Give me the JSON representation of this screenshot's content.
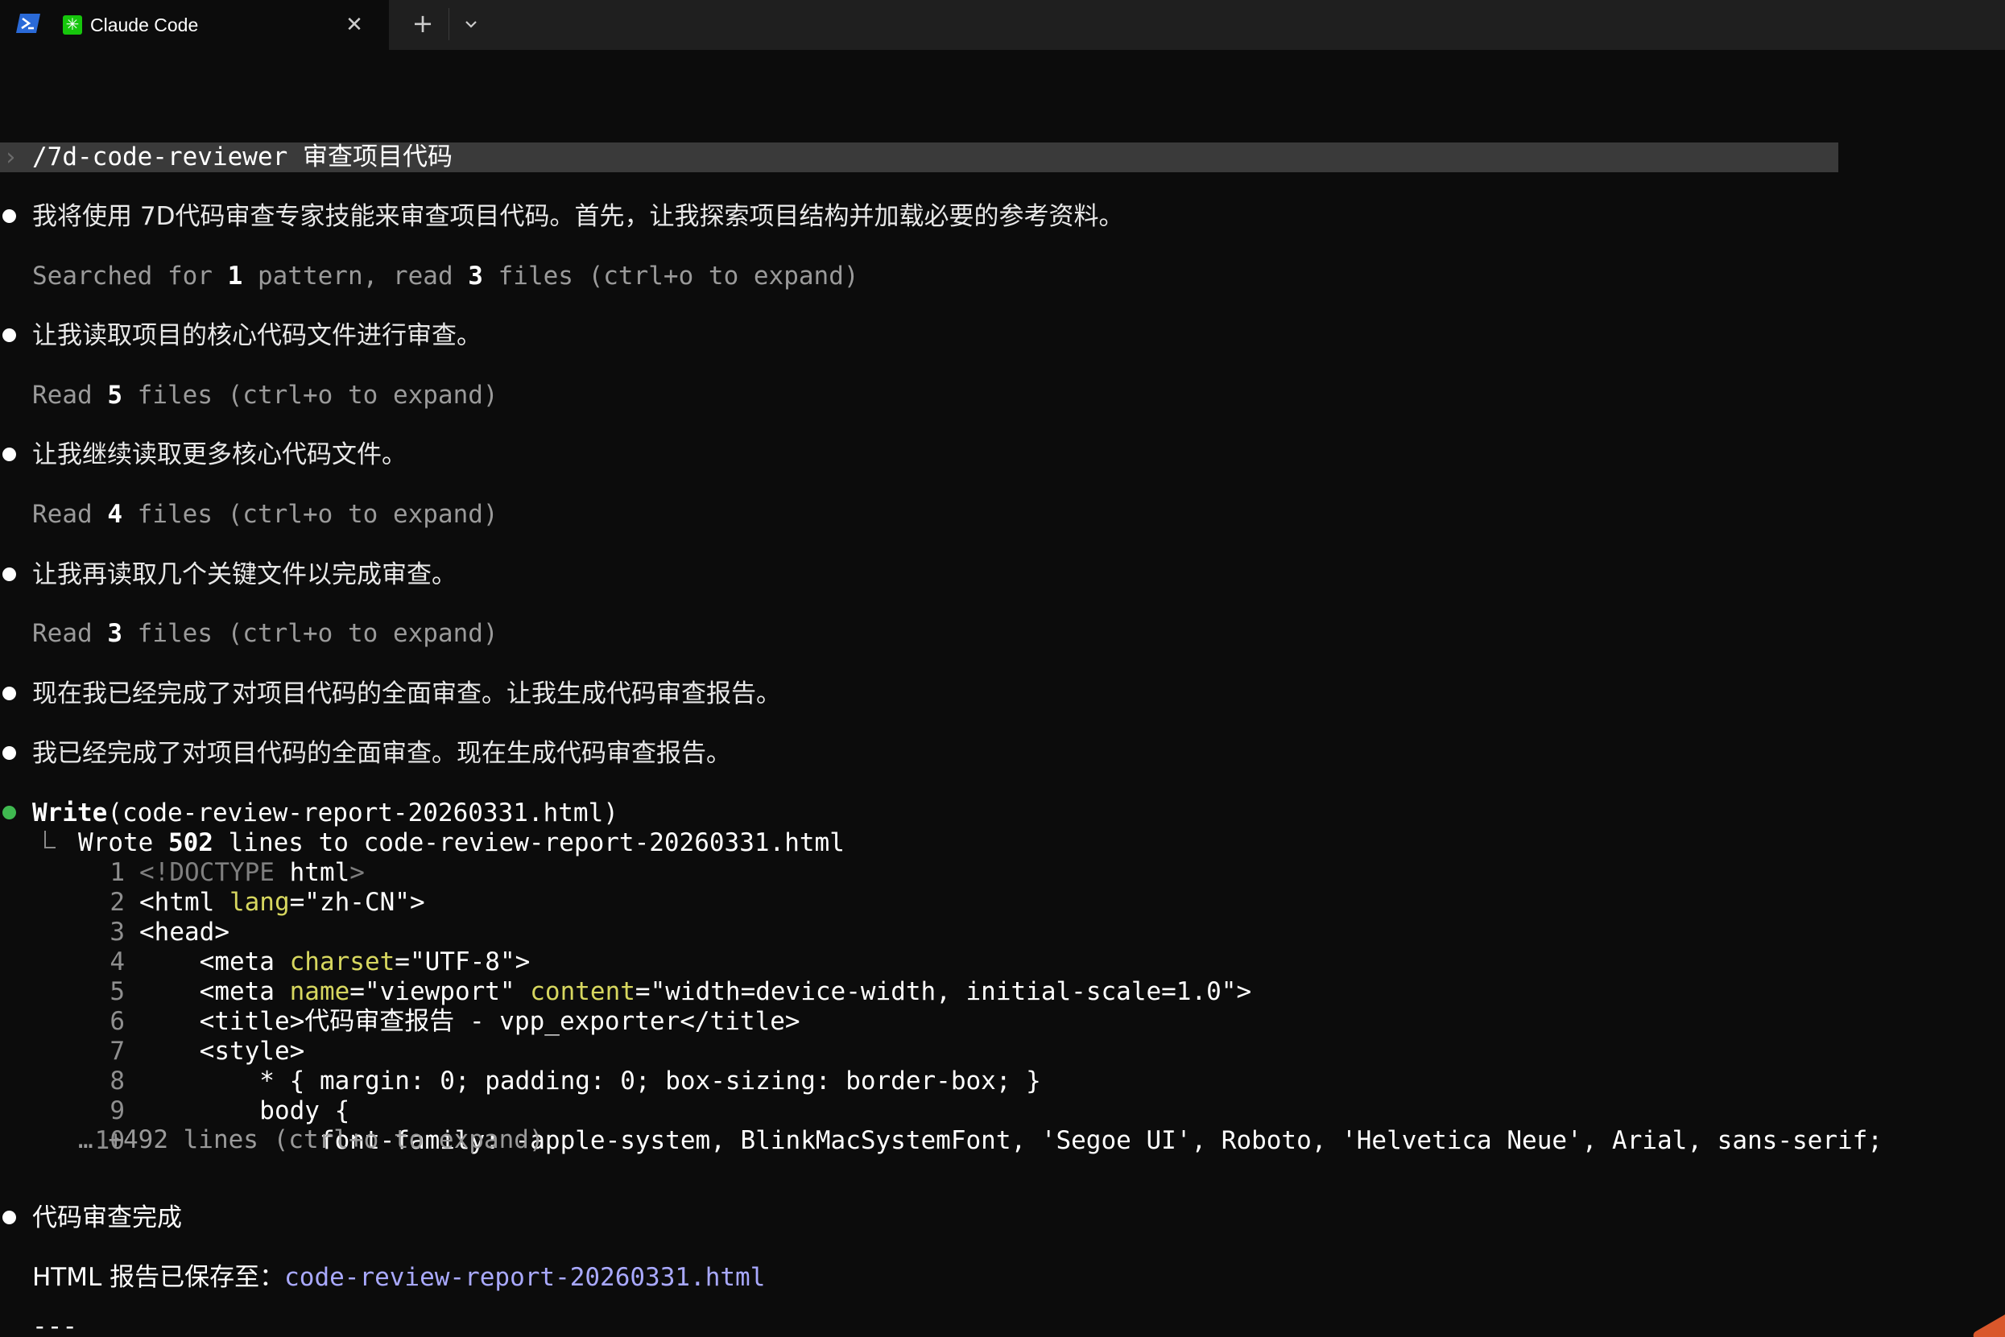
{
  "window": {
    "tab_title": "Claude Code",
    "close_glyph": "✕",
    "new_tab_glyph": "+",
    "shell_icon": "powershell-icon",
    "app_icon": "claude-code-icon",
    "app_icon_glyph": "✳"
  },
  "colors": {
    "background": "#0c0c0c",
    "titlebar": "#1f1f1f",
    "prompt_bar": "#3a3a3a",
    "bullet_white": "#ffffff",
    "bullet_green": "#3fb950",
    "attr_yellow": "#d7d75f",
    "link": "#a9a9ff"
  },
  "prompt": {
    "chevron": "›",
    "text": "/7d-code-reviewer 审查项目代码"
  },
  "transcript": {
    "msg1": "我将使用 7D代码审查专家技能来审查项目代码。首先，让我探索项目结构并加载必要的参考资料。",
    "tool1": {
      "a": "Searched for ",
      "n1": "1",
      "b": " pattern, read ",
      "n2": "3",
      "c": " files (ctrl+o to expand)"
    },
    "msg2": "让我读取项目的核心代码文件进行审查。",
    "tool2": {
      "a": "Read ",
      "n": "5",
      "b": " files (ctrl+o to expand)"
    },
    "msg3": "让我继续读取更多核心代码文件。",
    "tool3": {
      "a": "Read ",
      "n": "4",
      "b": " files (ctrl+o to expand)"
    },
    "msg4": "让我再读取几个关键文件以完成审查。",
    "tool4": {
      "a": "Read ",
      "n": "3",
      "b": " files (ctrl+o to expand)"
    },
    "msg5": "现在我已经完成了对项目代码的全面审查。让我生成代码审查报告。",
    "msg6": "我已经完成了对项目代码的全面审查。现在生成代码审查报告。",
    "write_call": {
      "name": "Write",
      "arg": "(code-review-report-20260331.html)",
      "result_a": "Wrote ",
      "result_n": "502",
      "result_b": " lines to code-review-report-20260331.html"
    },
    "code_lines": [
      {
        "n": "1",
        "parts": [
          [
            "gray",
            "<!DOCTYPE "
          ],
          [
            "white",
            "html"
          ],
          [
            "gray",
            ">"
          ]
        ]
      },
      {
        "n": "2",
        "parts": [
          [
            "white",
            "<html "
          ],
          [
            "yellow",
            "lang"
          ],
          [
            "white",
            "=\"zh-CN\">"
          ]
        ]
      },
      {
        "n": "3",
        "parts": [
          [
            "white",
            "<head>"
          ]
        ]
      },
      {
        "n": "4",
        "parts": [
          [
            "white",
            "    <meta "
          ],
          [
            "yellow",
            "charset"
          ],
          [
            "white",
            "=\"UTF-8\">"
          ]
        ]
      },
      {
        "n": "5",
        "parts": [
          [
            "white",
            "    <meta "
          ],
          [
            "yellow",
            "name"
          ],
          [
            "white",
            "=\"viewport\" "
          ],
          [
            "yellow",
            "content"
          ],
          [
            "white",
            "=\"width=device-width, initial-scale=1.0\">"
          ]
        ]
      },
      {
        "n": "6",
        "parts": [
          [
            "white",
            "    <title>代码审查报告 - vpp_exporter</title>"
          ]
        ]
      },
      {
        "n": "7",
        "parts": [
          [
            "white",
            "    <style>"
          ]
        ]
      },
      {
        "n": "8",
        "parts": [
          [
            "white",
            "        * { margin: 0; padding: 0; box-sizing: border-box; }"
          ]
        ]
      },
      {
        "n": "9",
        "parts": [
          [
            "white",
            "        body {"
          ]
        ]
      },
      {
        "n": "10",
        "parts": [
          [
            "white",
            "            font-family: -apple-system, BlinkMacSystemFont, 'Segoe UI', Roboto, 'Helvetica Neue', Arial, sans-serif;"
          ]
        ]
      }
    ],
    "more_lines": "… +492 lines (ctrl+o to expand)",
    "msg7": "代码审查完成",
    "saved_label": "HTML 报告已保存至：",
    "saved_link": "code-review-report-20260331.html",
    "separator": "---"
  }
}
